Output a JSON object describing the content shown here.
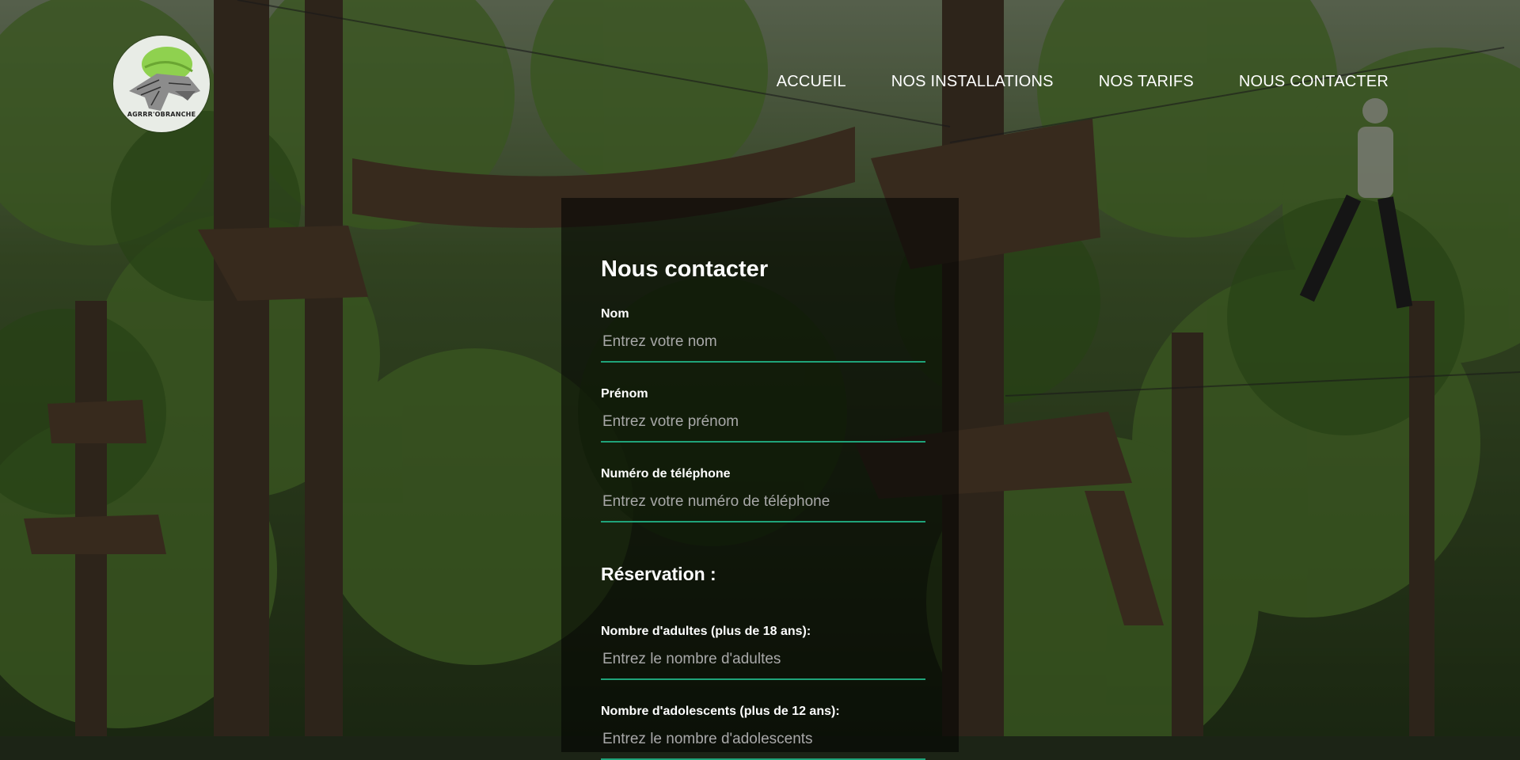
{
  "logo": {
    "brand_text": "AGRRR'OBRANCHE",
    "icon": "dinosaur-helmet-logo"
  },
  "nav": {
    "items": [
      "ACCUEIL",
      "NOS INSTALLATIONS",
      "NOS TARIFS",
      "NOUS CONTACTER"
    ]
  },
  "form": {
    "title": "Nous contacter",
    "fields": [
      {
        "label": "Nom",
        "placeholder": "Entrez votre nom"
      },
      {
        "label": "Prénom",
        "placeholder": "Entrez votre prénom"
      },
      {
        "label": "Numéro de téléphone",
        "placeholder": "Entrez votre numéro de téléphone"
      }
    ],
    "reservation_title": "Réservation :",
    "reservation_fields": [
      {
        "label": "Nombre d'adultes (plus de 18 ans):",
        "placeholder": "Entrez le nombre d'adultes"
      },
      {
        "label": "Nombre d'adolescents (plus de 12 ans):",
        "placeholder": "Entrez le nombre d'adolescents"
      }
    ]
  },
  "colors": {
    "accent": "#1fa37a",
    "logo_green": "#8fd14f"
  }
}
